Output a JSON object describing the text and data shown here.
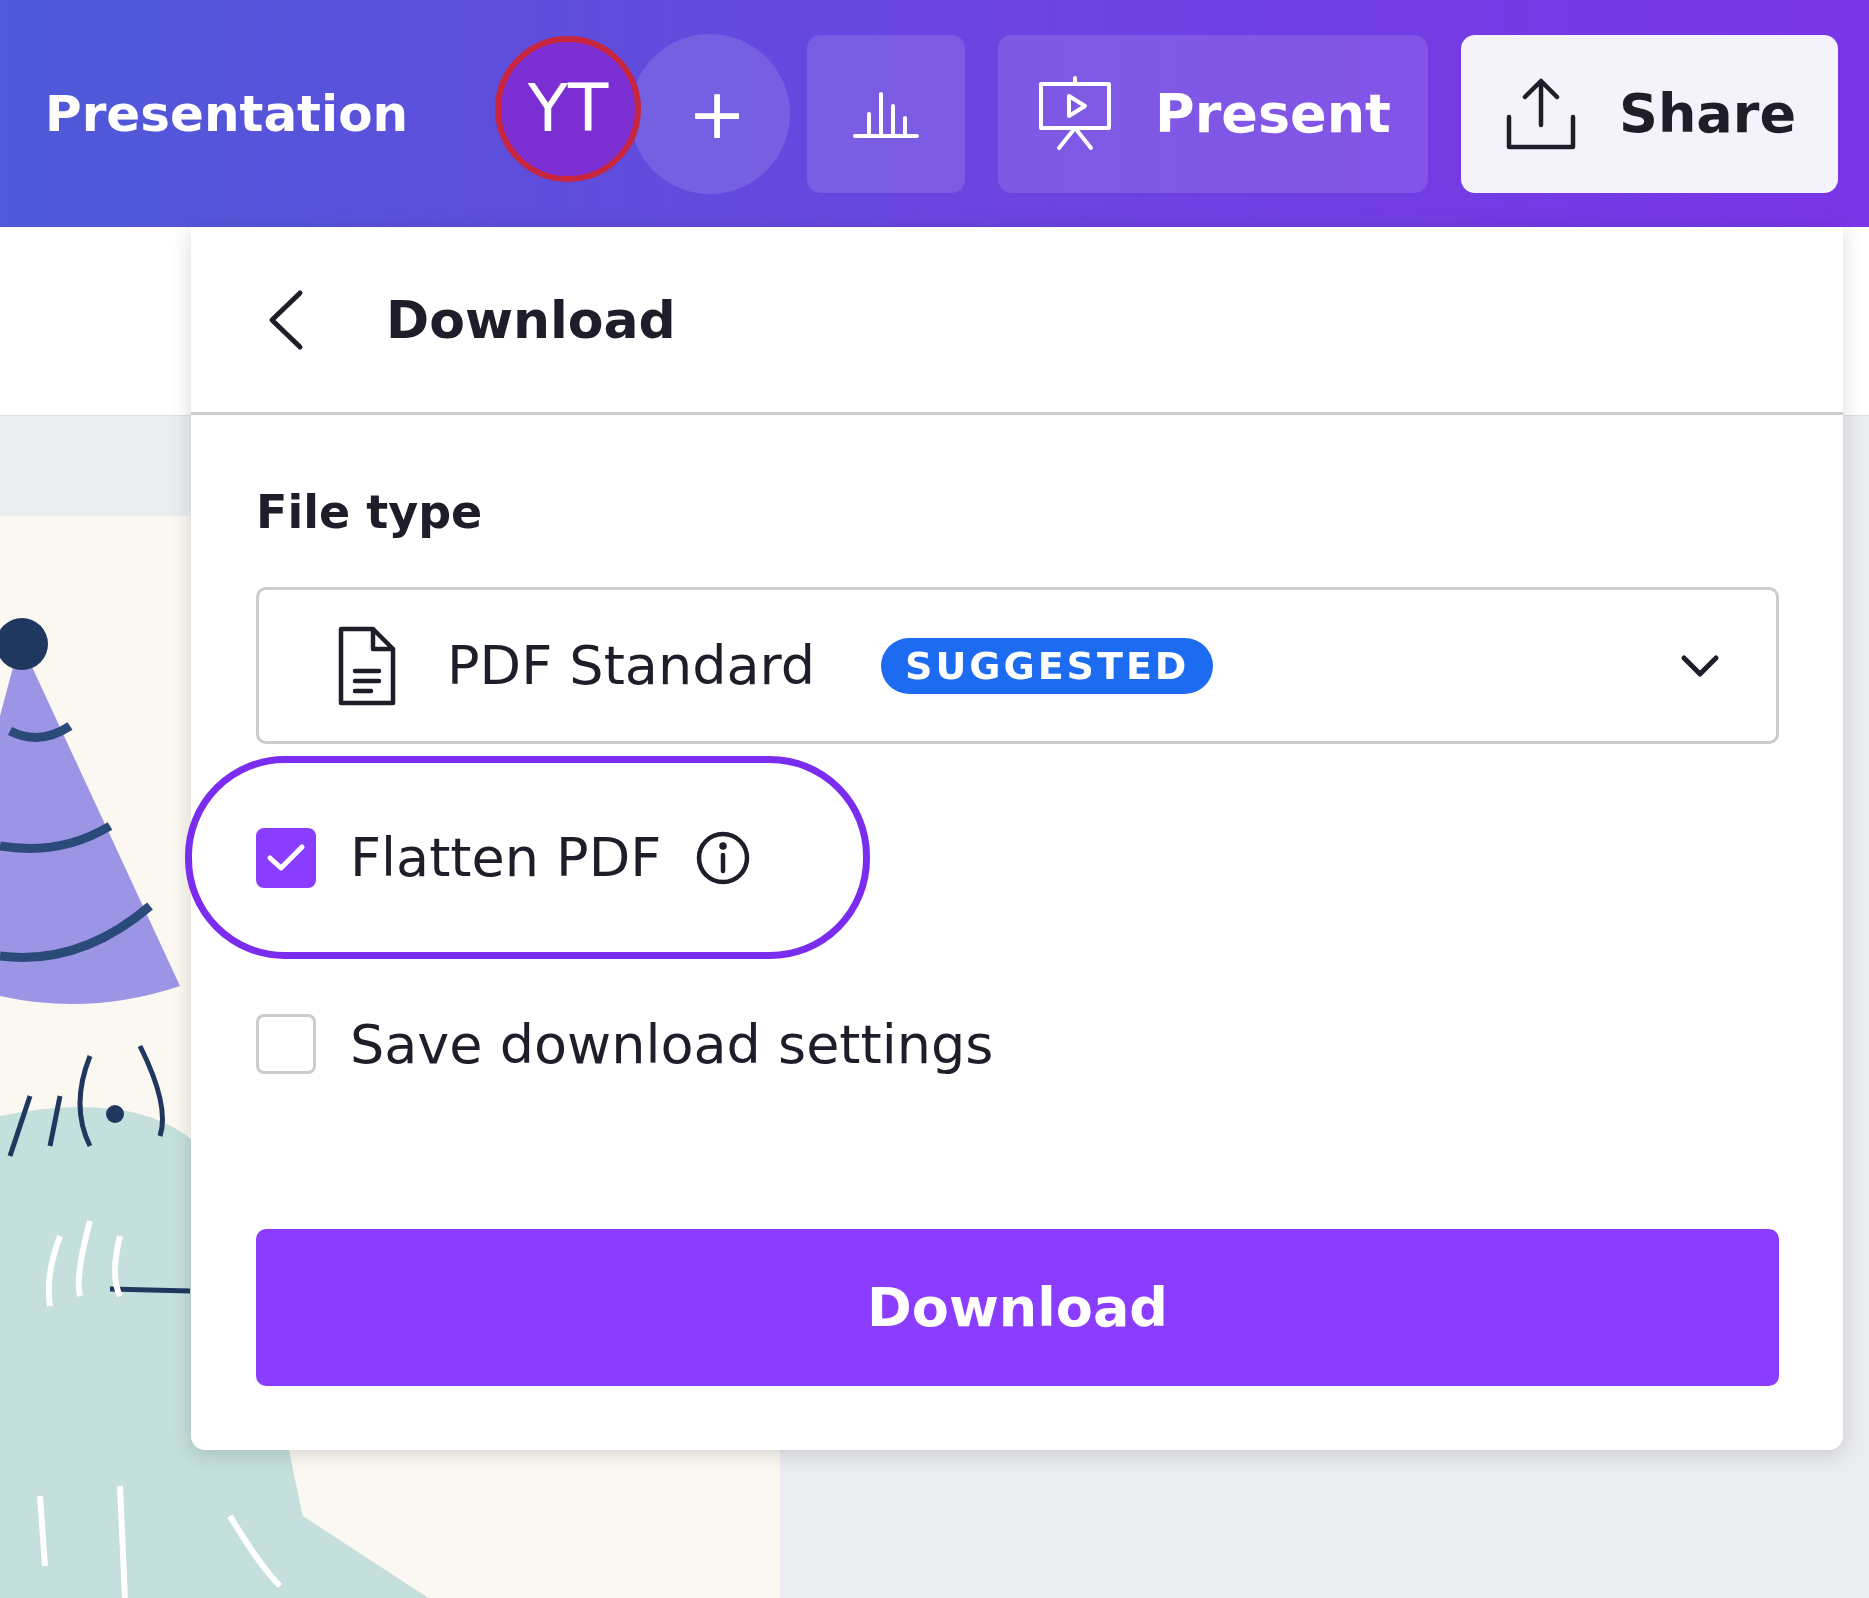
{
  "header": {
    "title": "Presentation",
    "avatar": "YT",
    "add": "+",
    "present": "Present",
    "share": "Share"
  },
  "panel": {
    "title": "Download",
    "file_type_label": "File type",
    "file_type": {
      "value": "PDF Standard",
      "badge": "SUGGESTED"
    },
    "options": [
      {
        "label": "Flatten PDF",
        "checked": true,
        "highlighted": true,
        "info": true
      },
      {
        "label": "Save download settings",
        "checked": false,
        "highlighted": false,
        "info": false
      }
    ],
    "button": "Download"
  }
}
